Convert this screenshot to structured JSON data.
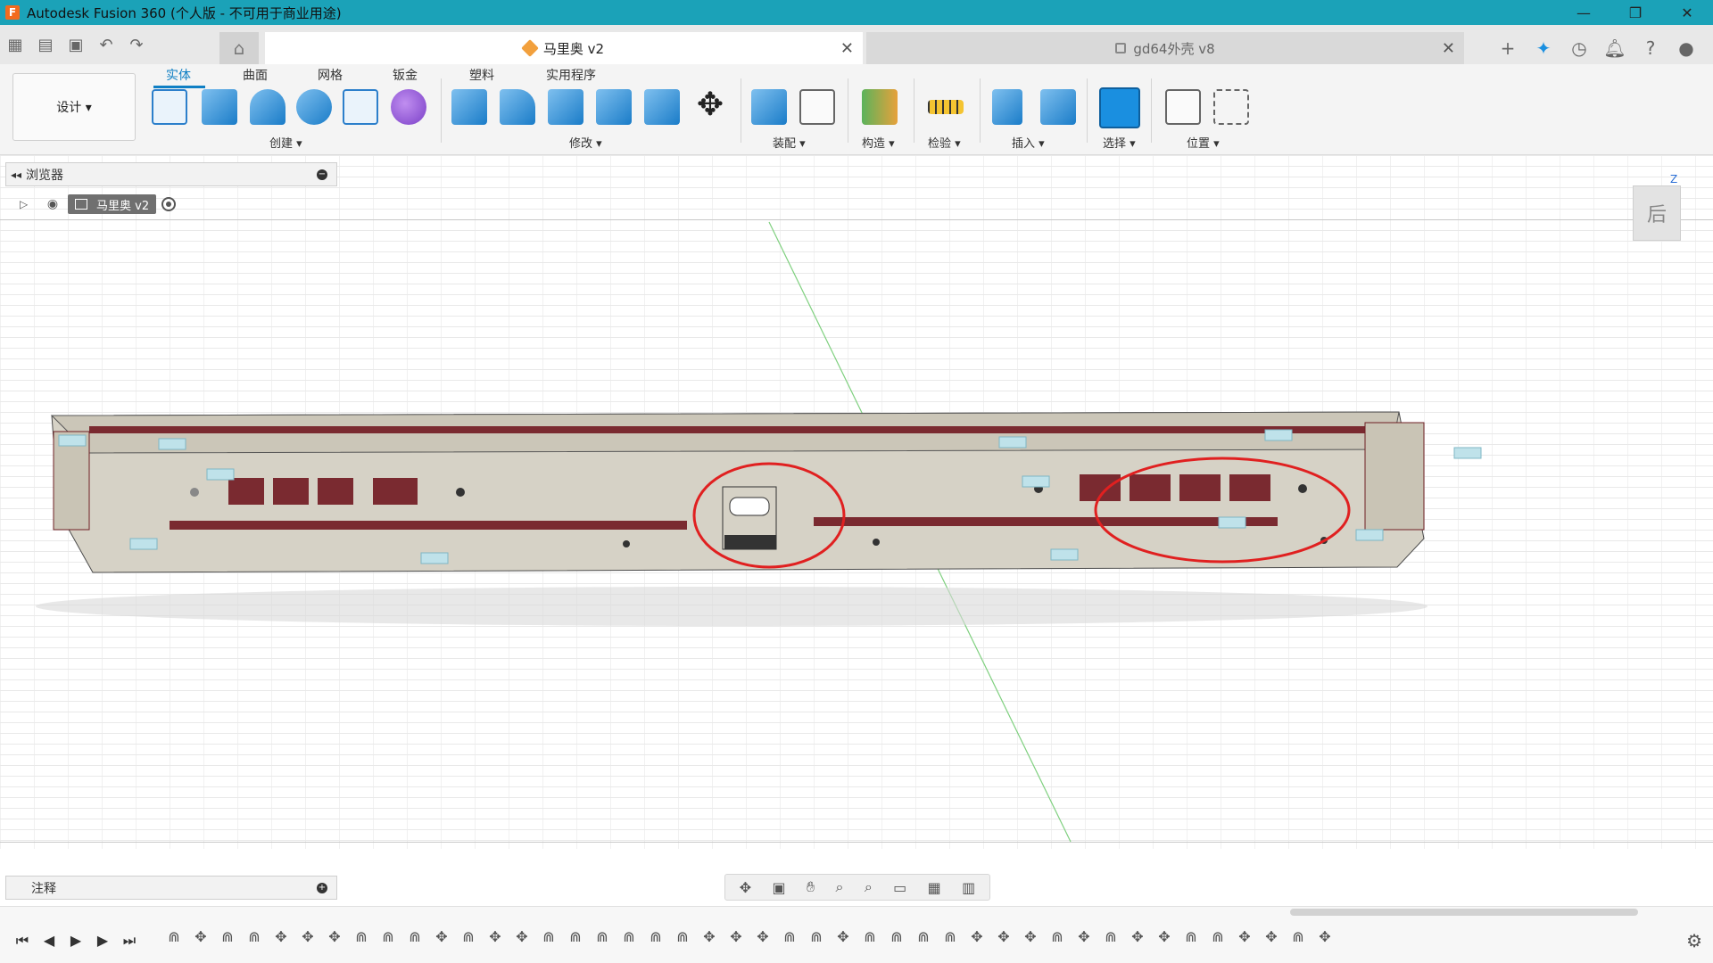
{
  "window": {
    "title": "Autodesk Fusion 360 (个人版 - 不可用于商业用途)",
    "app_icon_letter": "F",
    "buttons": [
      "—",
      "❐",
      "✕"
    ]
  },
  "tabs": {
    "active": {
      "label": "马里奥 v2"
    },
    "inactive": {
      "label": "gd64外壳 v8"
    },
    "close_glyph": "✕"
  },
  "toolbar": {
    "workspace_label": "设计 ▾",
    "ribbon_tabs": [
      "实体",
      "曲面",
      "网格",
      "钣金",
      "塑料",
      "实用程序"
    ],
    "active_ribbon_tab": "实体",
    "groups": {
      "create": "创建 ▾",
      "modify": "修改 ▾",
      "assemble": "装配 ▾",
      "construct": "构造 ▾",
      "inspect": "检验 ▾",
      "insert": "插入 ▾",
      "select": "选择 ▾",
      "position": "位置 ▾"
    }
  },
  "browser": {
    "title": "浏览器",
    "root_node": "马里奥 v2"
  },
  "viewcube": {
    "face": "后",
    "axis_z": "Z"
  },
  "notes": {
    "title": "注释"
  },
  "colors": {
    "title_bar": "#1ba2b8",
    "accent": "#0f7fc4",
    "model_body": "#d6d2c6",
    "model_dark": "#6e1f24",
    "annotation": "#e02020"
  }
}
